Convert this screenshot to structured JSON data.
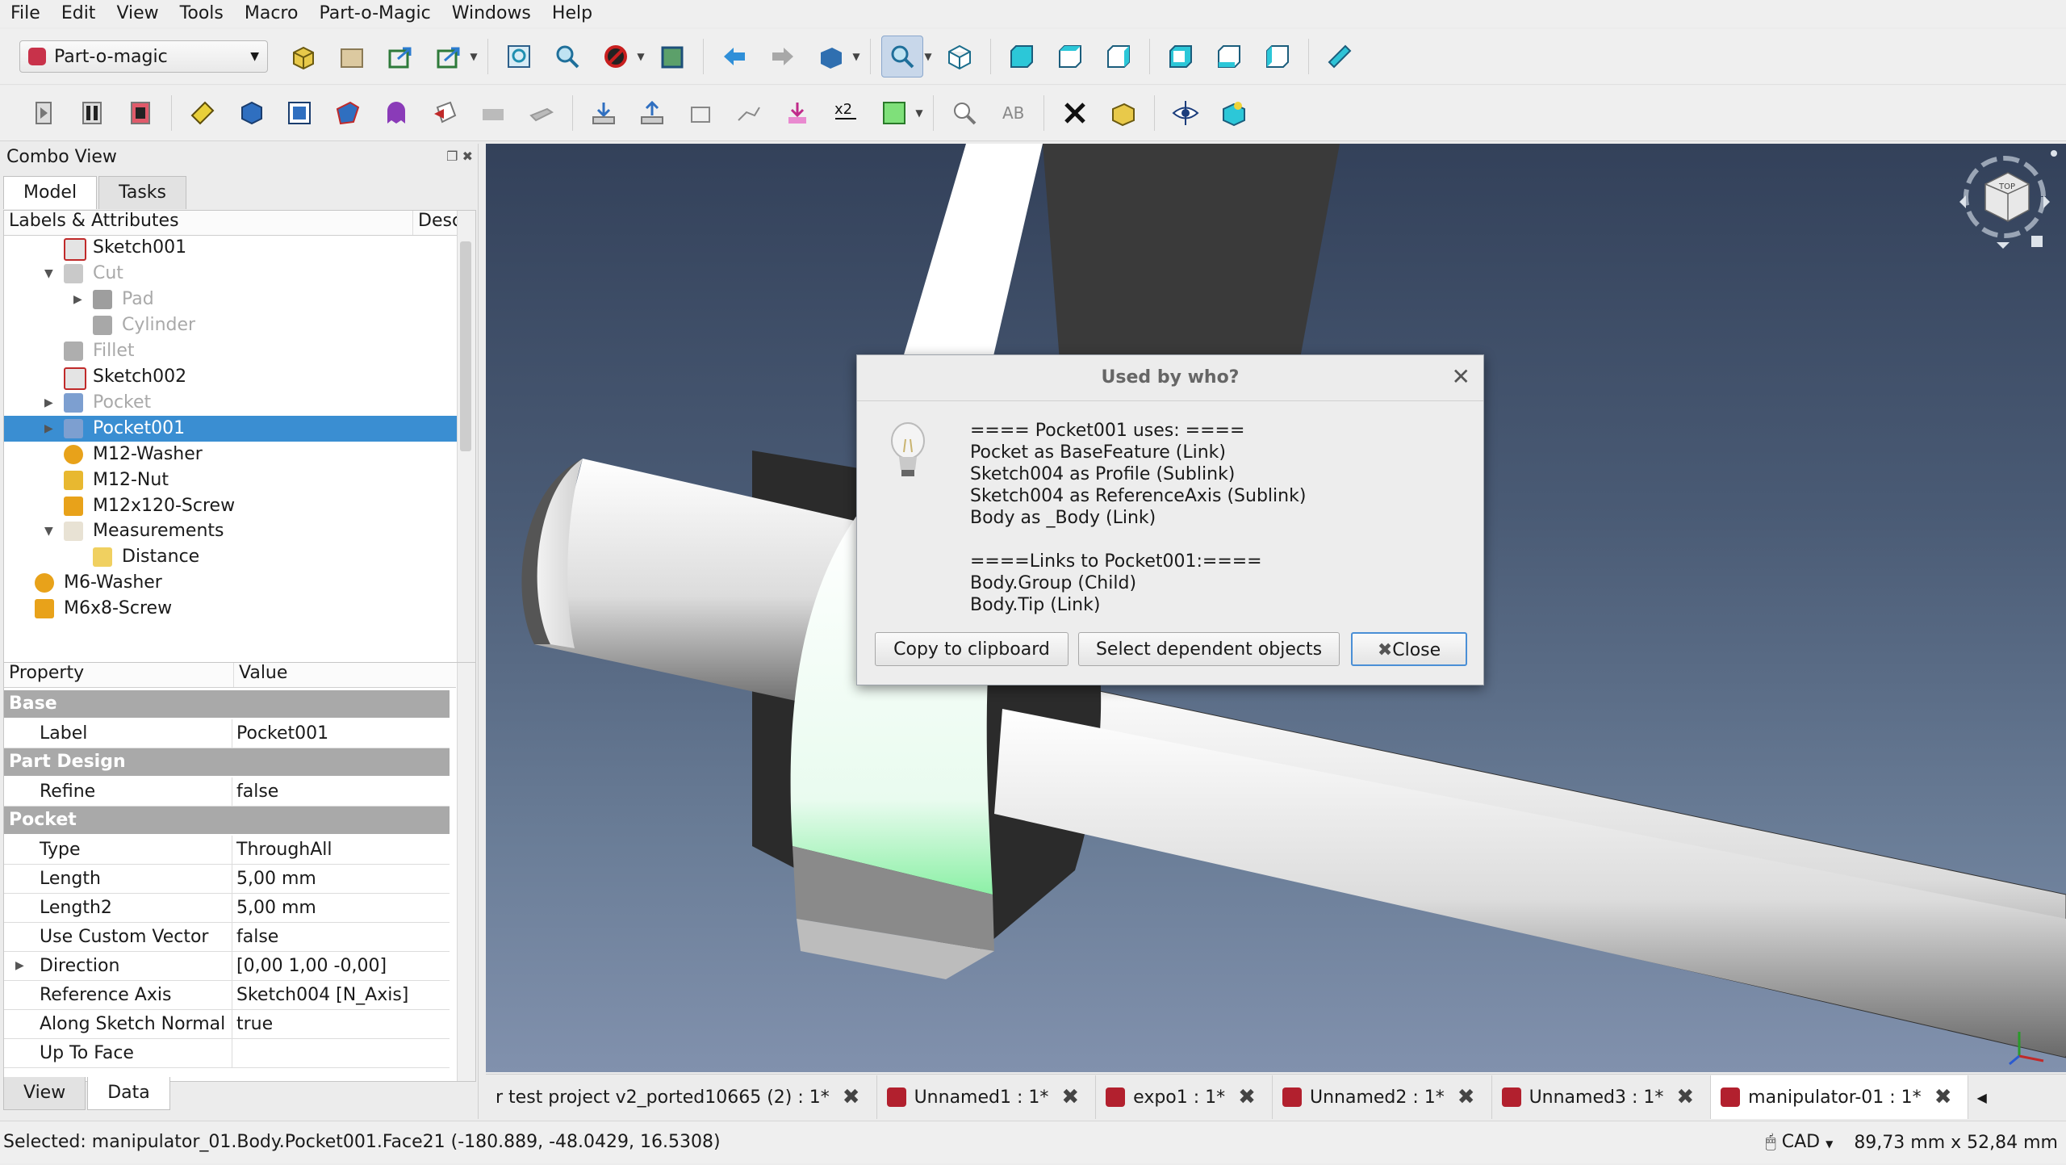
{
  "menu": [
    "File",
    "Edit",
    "View",
    "Tools",
    "Macro",
    "Part-o-Magic",
    "Windows",
    "Help"
  ],
  "workbench": "Part-o-magic",
  "toolbar1_icons": [
    "new-container-icon",
    "open-folder-icon",
    "export-icon",
    "export-all-icon",
    "fit-all-icon",
    "fit-selection-icon",
    "draw-style-icon",
    "stereo-icon",
    "back-icon",
    "forward-icon",
    "sync-view-icon",
    "zoom-box-icon",
    "isometric-icon",
    "front-view-icon",
    "top-view-icon",
    "right-view-icon",
    "rear-view-icon",
    "bottom-view-icon",
    "left-view-icon",
    "measure-icon"
  ],
  "combo": {
    "title": "Combo View",
    "tabs": [
      "Model",
      "Tasks"
    ],
    "tree_headers": [
      "Labels & Attributes",
      "Desc"
    ],
    "tree": [
      {
        "label": "Sketch001",
        "indent": 0,
        "icon": "sketch-icon",
        "expander": "",
        "dim": false,
        "selected": false
      },
      {
        "label": "Cut",
        "indent": 0,
        "icon": "cut-icon",
        "expander": "▼",
        "dim": true,
        "selected": false
      },
      {
        "label": "Pad",
        "indent": 1,
        "icon": "pad-icon",
        "expander": "▶",
        "dim": true,
        "selected": false
      },
      {
        "label": "Cylinder",
        "indent": 1,
        "icon": "cylinder-icon",
        "expander": "",
        "dim": true,
        "selected": false
      },
      {
        "label": "Fillet",
        "indent": 0,
        "icon": "fillet-icon",
        "expander": "",
        "dim": true,
        "selected": false
      },
      {
        "label": "Sketch002",
        "indent": 0,
        "icon": "sketch-icon",
        "expander": "",
        "dim": false,
        "selected": false
      },
      {
        "label": "Pocket",
        "indent": 0,
        "icon": "pocket-icon",
        "expander": "▶",
        "dim": true,
        "selected": false
      },
      {
        "label": "Pocket001",
        "indent": 0,
        "icon": "pocket-icon",
        "expander": "▶",
        "dim": false,
        "selected": true
      },
      {
        "label": "M12-Washer",
        "indent": 0,
        "icon": "washer-icon",
        "expander": "",
        "dim": false,
        "selected": false
      },
      {
        "label": "M12-Nut",
        "indent": 0,
        "icon": "nut-icon",
        "expander": "",
        "dim": false,
        "selected": false
      },
      {
        "label": "M12x120-Screw",
        "indent": 0,
        "icon": "screw-icon",
        "expander": "",
        "dim": false,
        "selected": false
      },
      {
        "label": "Measurements",
        "indent": 0,
        "icon": "folder-icon",
        "expander": "▼",
        "dim": false,
        "selected": false
      },
      {
        "label": "Distance",
        "indent": 1,
        "icon": "distance-icon",
        "expander": "",
        "dim": false,
        "selected": false
      },
      {
        "label": "M6-Washer",
        "indent": -1,
        "icon": "washer-icon",
        "expander": "",
        "dim": false,
        "selected": false
      },
      {
        "label": "M6x8-Screw",
        "indent": -1,
        "icon": "screw-icon",
        "expander": "",
        "dim": false,
        "selected": false
      }
    ],
    "prop_headers": [
      "Property",
      "Value"
    ],
    "properties": [
      {
        "group": "Base"
      },
      {
        "name": "Label",
        "value": "Pocket001"
      },
      {
        "group": "Part Design"
      },
      {
        "name": "Refine",
        "value": "false"
      },
      {
        "group": "Pocket"
      },
      {
        "name": "Type",
        "value": "ThroughAll"
      },
      {
        "name": "Length",
        "value": "5,00 mm"
      },
      {
        "name": "Length2",
        "value": "5,00 mm"
      },
      {
        "name": "Use Custom Vector",
        "value": "false"
      },
      {
        "name": "Direction",
        "value": "[0,00 1,00 -0,00]",
        "expander": "▶"
      },
      {
        "name": "Reference Axis",
        "value": "Sketch004 [N_Axis]"
      },
      {
        "name": "Along Sketch Normal",
        "value": "true"
      },
      {
        "name": "Up To Face",
        "value": ""
      }
    ],
    "bottom_tabs": [
      "View",
      "Data"
    ]
  },
  "doc_tabs": [
    {
      "label": "r test project v2_ported10665 (2) : 1*",
      "active": false
    },
    {
      "label": "Unnamed1 : 1*",
      "active": false
    },
    {
      "label": "expo1 : 1*",
      "active": false
    },
    {
      "label": "Unnamed2 : 1*",
      "active": false
    },
    {
      "label": "Unnamed3 : 1*",
      "active": false
    },
    {
      "label": "manipulator-01 : 1*",
      "active": true
    }
  ],
  "status": {
    "selected": "Selected: manipulator_01.Body.Pocket001.Face21 (-180.889, -48.0429, 16.5308)",
    "nav_style": "CAD",
    "dims": "89,73 mm x 52,84 mm"
  },
  "navcube": {
    "top_label": "TOP"
  },
  "dialog": {
    "title": "Used by who?",
    "lines": [
      "==== Pocket001 uses: ====",
      "Pocket as BaseFeature (Link)",
      "Sketch004 as Profile (Sublink)",
      "Sketch004 as ReferenceAxis (Sublink)",
      "Body as _Body (Link)",
      "",
      "====Links to Pocket001:====",
      "Body.Group (Child)",
      "Body.Tip (Link)"
    ],
    "buttons": {
      "copy": "Copy to clipboard",
      "select": "Select dependent objects",
      "close": "Close"
    }
  },
  "colors": {
    "selection": "#3a8ed2",
    "group_header": "#a9a9a9",
    "highlight_face": "#b4f5c6"
  }
}
